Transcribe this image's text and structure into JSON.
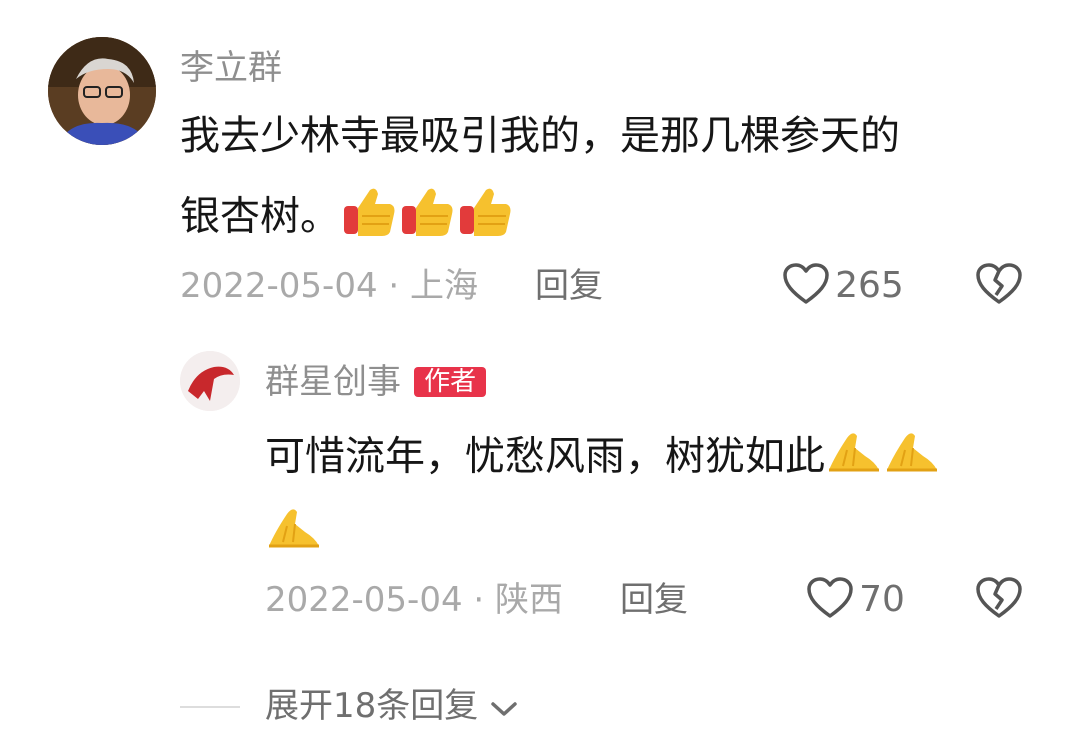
{
  "comment": {
    "username": "李立群",
    "text_line1": "我去少林寺最吸引我的，是那几棵参天的",
    "text_line2": "银杏树。",
    "date": "2022-05-04",
    "separator": "·",
    "location": "上海",
    "reply_label": "回复",
    "like_count": "265",
    "emojis": [
      "thumbs-up-emoji",
      "thumbs-up-emoji",
      "thumbs-up-emoji"
    ]
  },
  "reply": {
    "username": "群星创事",
    "author_badge": "作者",
    "text_line1": "可惜流年，忧愁风雨，树犹如此",
    "date": "2022-05-04",
    "separator": "·",
    "location": "陕西",
    "reply_label": "回复",
    "like_count": "70",
    "emojis": [
      "praying-hands-emoji",
      "praying-hands-emoji",
      "praying-hands-emoji"
    ]
  },
  "expand_replies": {
    "label": "展开18条回复"
  },
  "colors": {
    "badge": "#e8334a",
    "username": "#8f8f8f",
    "meta": "#a9a9a9"
  }
}
